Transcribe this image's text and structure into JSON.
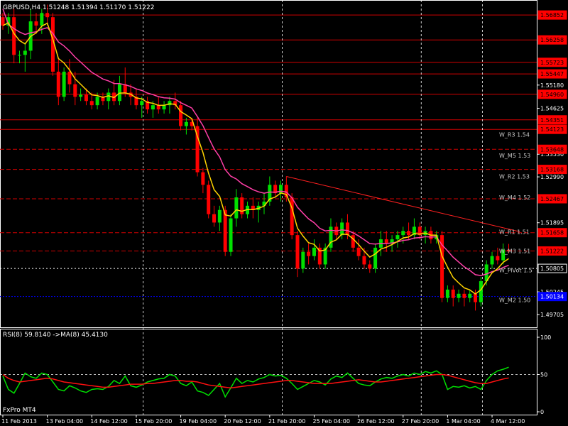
{
  "chart_data": [
    {
      "type": "candlestick",
      "title": "GBPUSD,H4  1.51248 1.51394 1.51170 1.51222",
      "ylim": [
        1.494,
        1.5721
      ],
      "grid": false,
      "colors": {
        "bull": "#00e000",
        "bear": "#ff0000",
        "ma_fast": "#ffd400",
        "ma_slow": "#ff3fa8",
        "trend": "#ff2020",
        "level": "#d00000",
        "pivot": "#ffffff",
        "m2": "#0000ff"
      },
      "price_ticks": [
        "1.55180",
        "1.54625",
        "1.53530",
        "1.52990",
        "1.51895",
        "1.50245",
        "1.49705"
      ],
      "levels": [
        {
          "value": 1.56852,
          "label": "1.56852",
          "style": "solid"
        },
        {
          "value": 1.56258,
          "label": "1.56258",
          "style": "solid"
        },
        {
          "value": 1.55723,
          "label": "1.55723",
          "style": "solid"
        },
        {
          "value": 1.55447,
          "label": "1.55447",
          "style": "solid"
        },
        {
          "value": 1.5496,
          "label": "1.54960",
          "style": "solid"
        },
        {
          "value": 1.54351,
          "label": "1.54351",
          "style": "solid"
        },
        {
          "value": 1.54123,
          "label": "1.54123",
          "style": "solid"
        },
        {
          "value": 1.53648,
          "label": "1.53648",
          "style": "dashed"
        },
        {
          "value": 1.53168,
          "label": "1.53168",
          "style": "dashed"
        },
        {
          "value": 1.52467,
          "label": "1.52467",
          "style": "dashed"
        },
        {
          "value": 1.51658,
          "label": "1.51658",
          "style": "dashed"
        },
        {
          "value": 1.51222,
          "label": "1.51222",
          "style": "dashed"
        },
        {
          "value": 1.50805,
          "label": "1.50805",
          "style": "pivot"
        },
        {
          "value": 1.50134,
          "label": "1.50134",
          "style": "m2"
        }
      ],
      "level_texts": [
        {
          "value": 1.54,
          "text": "W_R3 1.54"
        },
        {
          "value": 1.535,
          "text": "W_M5 1.53"
        },
        {
          "value": 1.53,
          "text": "W_R2 1.53"
        },
        {
          "value": 1.525,
          "text": "W_M4 1.52"
        },
        {
          "value": 1.5168,
          "text": "W_R1 1.51"
        },
        {
          "value": 1.5122,
          "text": "W_M3 1.51"
        },
        {
          "value": 1.5076,
          "text": "W_Pivot 1.5"
        },
        {
          "value": 1.5005,
          "text": "W_M2 1.50"
        }
      ],
      "trendline": {
        "from": {
          "bar": 51,
          "value": 1.53
        },
        "to": {
          "bar": 93,
          "value": 1.5168
        }
      },
      "x_ticks": [
        {
          "bar": 0,
          "label": "11 Feb 2013"
        },
        {
          "bar": 8,
          "label": "13 Feb 04:00"
        },
        {
          "bar": 16,
          "label": "14 Feb 12:00"
        },
        {
          "bar": 24,
          "label": "15 Feb 20:00"
        },
        {
          "bar": 32,
          "label": "19 Feb 04:00"
        },
        {
          "bar": 40,
          "label": "20 Feb 12:00"
        },
        {
          "bar": 48,
          "label": "21 Feb 20:00"
        },
        {
          "bar": 56,
          "label": "25 Feb 04:00"
        },
        {
          "bar": 64,
          "label": "26 Feb 12:00"
        },
        {
          "bar": 72,
          "label": "27 Feb 20:00"
        },
        {
          "bar": 80,
          "label": "1 Mar 04:00"
        },
        {
          "bar": 88,
          "label": "4 Mar 12:00"
        }
      ],
      "dashed_vertical_bars": [
        25,
        50,
        75,
        86
      ],
      "candles": [
        {
          "o": 1.568,
          "h": 1.569,
          "l": 1.565,
          "c": 1.566
        },
        {
          "o": 1.566,
          "h": 1.569,
          "l": 1.564,
          "c": 1.568
        },
        {
          "o": 1.568,
          "h": 1.57,
          "l": 1.557,
          "c": 1.559
        },
        {
          "o": 1.559,
          "h": 1.56,
          "l": 1.557,
          "c": 1.559
        },
        {
          "o": 1.559,
          "h": 1.562,
          "l": 1.555,
          "c": 1.56
        },
        {
          "o": 1.56,
          "h": 1.57,
          "l": 1.558,
          "c": 1.567
        },
        {
          "o": 1.567,
          "h": 1.569,
          "l": 1.564,
          "c": 1.566
        },
        {
          "o": 1.566,
          "h": 1.57,
          "l": 1.564,
          "c": 1.569
        },
        {
          "o": 1.569,
          "h": 1.571,
          "l": 1.566,
          "c": 1.568
        },
        {
          "o": 1.568,
          "h": 1.569,
          "l": 1.554,
          "c": 1.555
        },
        {
          "o": 1.555,
          "h": 1.558,
          "l": 1.547,
          "c": 1.549
        },
        {
          "o": 1.549,
          "h": 1.556,
          "l": 1.548,
          "c": 1.555
        },
        {
          "o": 1.555,
          "h": 1.558,
          "l": 1.55,
          "c": 1.552
        },
        {
          "o": 1.552,
          "h": 1.555,
          "l": 1.547,
          "c": 1.549
        },
        {
          "o": 1.549,
          "h": 1.551,
          "l": 1.548,
          "c": 1.5495
        },
        {
          "o": 1.5495,
          "h": 1.551,
          "l": 1.547,
          "c": 1.548
        },
        {
          "o": 1.548,
          "h": 1.55,
          "l": 1.546,
          "c": 1.547
        },
        {
          "o": 1.547,
          "h": 1.55,
          "l": 1.546,
          "c": 1.549
        },
        {
          "o": 1.549,
          "h": 1.55,
          "l": 1.547,
          "c": 1.548
        },
        {
          "o": 1.548,
          "h": 1.551,
          "l": 1.546,
          "c": 1.55
        },
        {
          "o": 1.55,
          "h": 1.553,
          "l": 1.547,
          "c": 1.548
        },
        {
          "o": 1.548,
          "h": 1.554,
          "l": 1.547,
          "c": 1.552
        },
        {
          "o": 1.552,
          "h": 1.556,
          "l": 1.549,
          "c": 1.55
        },
        {
          "o": 1.55,
          "h": 1.552,
          "l": 1.547,
          "c": 1.549
        },
        {
          "o": 1.549,
          "h": 1.551,
          "l": 1.546,
          "c": 1.547
        },
        {
          "o": 1.547,
          "h": 1.549,
          "l": 1.544,
          "c": 1.548
        },
        {
          "o": 1.548,
          "h": 1.549,
          "l": 1.545,
          "c": 1.546
        },
        {
          "o": 1.546,
          "h": 1.548,
          "l": 1.544,
          "c": 1.547
        },
        {
          "o": 1.547,
          "h": 1.549,
          "l": 1.545,
          "c": 1.546
        },
        {
          "o": 1.546,
          "h": 1.548,
          "l": 1.545,
          "c": 1.547
        },
        {
          "o": 1.547,
          "h": 1.549,
          "l": 1.545,
          "c": 1.548
        },
        {
          "o": 1.548,
          "h": 1.55,
          "l": 1.546,
          "c": 1.547
        },
        {
          "o": 1.547,
          "h": 1.548,
          "l": 1.541,
          "c": 1.542
        },
        {
          "o": 1.542,
          "h": 1.544,
          "l": 1.54,
          "c": 1.543
        },
        {
          "o": 1.543,
          "h": 1.544,
          "l": 1.541,
          "c": 1.542
        },
        {
          "o": 1.542,
          "h": 1.544,
          "l": 1.53,
          "c": 1.531
        },
        {
          "o": 1.531,
          "h": 1.532,
          "l": 1.526,
          "c": 1.528
        },
        {
          "o": 1.528,
          "h": 1.529,
          "l": 1.52,
          "c": 1.521
        },
        {
          "o": 1.521,
          "h": 1.523,
          "l": 1.518,
          "c": 1.519
        },
        {
          "o": 1.519,
          "h": 1.523,
          "l": 1.517,
          "c": 1.522
        },
        {
          "o": 1.522,
          "h": 1.523,
          "l": 1.511,
          "c": 1.512
        },
        {
          "o": 1.512,
          "h": 1.521,
          "l": 1.511,
          "c": 1.52
        },
        {
          "o": 1.52,
          "h": 1.527,
          "l": 1.518,
          "c": 1.525
        },
        {
          "o": 1.525,
          "h": 1.526,
          "l": 1.52,
          "c": 1.521
        },
        {
          "o": 1.521,
          "h": 1.524,
          "l": 1.52,
          "c": 1.523
        },
        {
          "o": 1.523,
          "h": 1.525,
          "l": 1.52,
          "c": 1.522
        },
        {
          "o": 1.522,
          "h": 1.524,
          "l": 1.519,
          "c": 1.523
        },
        {
          "o": 1.523,
          "h": 1.526,
          "l": 1.521,
          "c": 1.524
        },
        {
          "o": 1.524,
          "h": 1.53,
          "l": 1.523,
          "c": 1.528
        },
        {
          "o": 1.528,
          "h": 1.529,
          "l": 1.525,
          "c": 1.526
        },
        {
          "o": 1.526,
          "h": 1.529,
          "l": 1.524,
          "c": 1.528
        },
        {
          "o": 1.528,
          "h": 1.53,
          "l": 1.524,
          "c": 1.525
        },
        {
          "o": 1.525,
          "h": 1.526,
          "l": 1.515,
          "c": 1.516
        },
        {
          "o": 1.516,
          "h": 1.517,
          "l": 1.506,
          "c": 1.508
        },
        {
          "o": 1.508,
          "h": 1.513,
          "l": 1.507,
          "c": 1.512
        },
        {
          "o": 1.512,
          "h": 1.514,
          "l": 1.509,
          "c": 1.511
        },
        {
          "o": 1.511,
          "h": 1.515,
          "l": 1.51,
          "c": 1.513
        },
        {
          "o": 1.513,
          "h": 1.514,
          "l": 1.508,
          "c": 1.509
        },
        {
          "o": 1.509,
          "h": 1.514,
          "l": 1.508,
          "c": 1.513
        },
        {
          "o": 1.513,
          "h": 1.52,
          "l": 1.512,
          "c": 1.518
        },
        {
          "o": 1.518,
          "h": 1.519,
          "l": 1.515,
          "c": 1.516
        },
        {
          "o": 1.516,
          "h": 1.52,
          "l": 1.515,
          "c": 1.519
        },
        {
          "o": 1.519,
          "h": 1.521,
          "l": 1.515,
          "c": 1.516
        },
        {
          "o": 1.516,
          "h": 1.517,
          "l": 1.512,
          "c": 1.513
        },
        {
          "o": 1.513,
          "h": 1.515,
          "l": 1.51,
          "c": 1.511
        },
        {
          "o": 1.511,
          "h": 1.513,
          "l": 1.508,
          "c": 1.509
        },
        {
          "o": 1.509,
          "h": 1.51,
          "l": 1.507,
          "c": 1.508
        },
        {
          "o": 1.508,
          "h": 1.514,
          "l": 1.507,
          "c": 1.513
        },
        {
          "o": 1.513,
          "h": 1.517,
          "l": 1.511,
          "c": 1.515
        },
        {
          "o": 1.515,
          "h": 1.517,
          "l": 1.512,
          "c": 1.514
        },
        {
          "o": 1.514,
          "h": 1.516,
          "l": 1.512,
          "c": 1.515
        },
        {
          "o": 1.515,
          "h": 1.517,
          "l": 1.513,
          "c": 1.516
        },
        {
          "o": 1.516,
          "h": 1.518,
          "l": 1.514,
          "c": 1.517
        },
        {
          "o": 1.517,
          "h": 1.519,
          "l": 1.515,
          "c": 1.516
        },
        {
          "o": 1.516,
          "h": 1.52,
          "l": 1.515,
          "c": 1.518
        },
        {
          "o": 1.518,
          "h": 1.519,
          "l": 1.515,
          "c": 1.516
        },
        {
          "o": 1.516,
          "h": 1.518,
          "l": 1.514,
          "c": 1.517
        },
        {
          "o": 1.517,
          "h": 1.518,
          "l": 1.514,
          "c": 1.515
        },
        {
          "o": 1.515,
          "h": 1.517,
          "l": 1.514,
          "c": 1.516
        },
        {
          "o": 1.516,
          "h": 1.517,
          "l": 1.5,
          "c": 1.501
        },
        {
          "o": 1.501,
          "h": 1.504,
          "l": 1.5,
          "c": 1.503
        },
        {
          "o": 1.503,
          "h": 1.504,
          "l": 1.499,
          "c": 1.501
        },
        {
          "o": 1.501,
          "h": 1.503,
          "l": 1.5,
          "c": 1.502
        },
        {
          "o": 1.502,
          "h": 1.503,
          "l": 1.499,
          "c": 1.501
        },
        {
          "o": 1.501,
          "h": 1.503,
          "l": 1.5,
          "c": 1.502
        },
        {
          "o": 1.502,
          "h": 1.503,
          "l": 1.498,
          "c": 1.5
        },
        {
          "o": 1.5,
          "h": 1.506,
          "l": 1.499,
          "c": 1.505
        },
        {
          "o": 1.505,
          "h": 1.51,
          "l": 1.504,
          "c": 1.509
        },
        {
          "o": 1.509,
          "h": 1.512,
          "l": 1.508,
          "c": 1.511
        },
        {
          "o": 1.511,
          "h": 1.513,
          "l": 1.509,
          "c": 1.51
        },
        {
          "o": 1.51,
          "h": 1.514,
          "l": 1.509,
          "c": 1.5125
        },
        {
          "o": 1.5125,
          "h": 1.5139,
          "l": 1.5117,
          "c": 1.5122
        }
      ]
    },
    {
      "type": "line",
      "title": "RSI(8) 59.8140  ->MA(8) 45.4130",
      "ylim": [
        0,
        100
      ],
      "levels": [
        {
          "value": 50,
          "style": "dashed"
        }
      ],
      "y_ticks": [
        {
          "value": 100,
          "label": "100"
        },
        {
          "value": 50,
          "label": "50"
        },
        {
          "value": 0,
          "label": "0"
        }
      ],
      "series": [
        {
          "color": "#00e000",
          "values": [
            48,
            30,
            25,
            38,
            52,
            47,
            45,
            52,
            50,
            40,
            30,
            28,
            35,
            32,
            28,
            26,
            30,
            31,
            30,
            34,
            42,
            38,
            48,
            35,
            33,
            36,
            40,
            42,
            44,
            45,
            50,
            48,
            38,
            35,
            40,
            28,
            26,
            22,
            30,
            38,
            20,
            32,
            45,
            38,
            42,
            40,
            44,
            46,
            50,
            48,
            49,
            45,
            38,
            30,
            34,
            38,
            42,
            40,
            36,
            44,
            48,
            46,
            52,
            45,
            38,
            36,
            35,
            40,
            44,
            46,
            45,
            48,
            50,
            48,
            52,
            50,
            54,
            52,
            55,
            50,
            30,
            34,
            33,
            35,
            32,
            34,
            30,
            42,
            50,
            55,
            57,
            59.8
          ]
        },
        {
          "color": "#ff1010",
          "values": [
            50,
            45,
            42,
            40,
            41,
            42,
            43,
            44,
            45,
            44,
            42,
            40,
            39,
            38,
            37,
            36,
            35,
            34,
            33,
            33,
            34,
            35,
            36,
            37,
            37,
            37,
            38,
            38,
            39,
            40,
            41,
            42,
            42,
            41,
            41,
            40,
            38,
            36,
            35,
            34,
            33,
            32,
            33,
            34,
            35,
            36,
            37,
            38,
            39,
            40,
            41,
            42,
            42,
            41,
            40,
            39,
            38,
            38,
            38,
            38,
            39,
            40,
            41,
            42,
            43,
            42,
            41,
            40,
            40,
            41,
            42,
            43,
            44,
            45,
            46,
            47,
            48,
            49,
            50,
            50,
            49,
            47,
            45,
            43,
            41,
            39,
            38,
            38,
            40,
            42,
            44,
            45.4
          ]
        }
      ]
    }
  ],
  "footer": {
    "label": "FxPro MT4"
  }
}
